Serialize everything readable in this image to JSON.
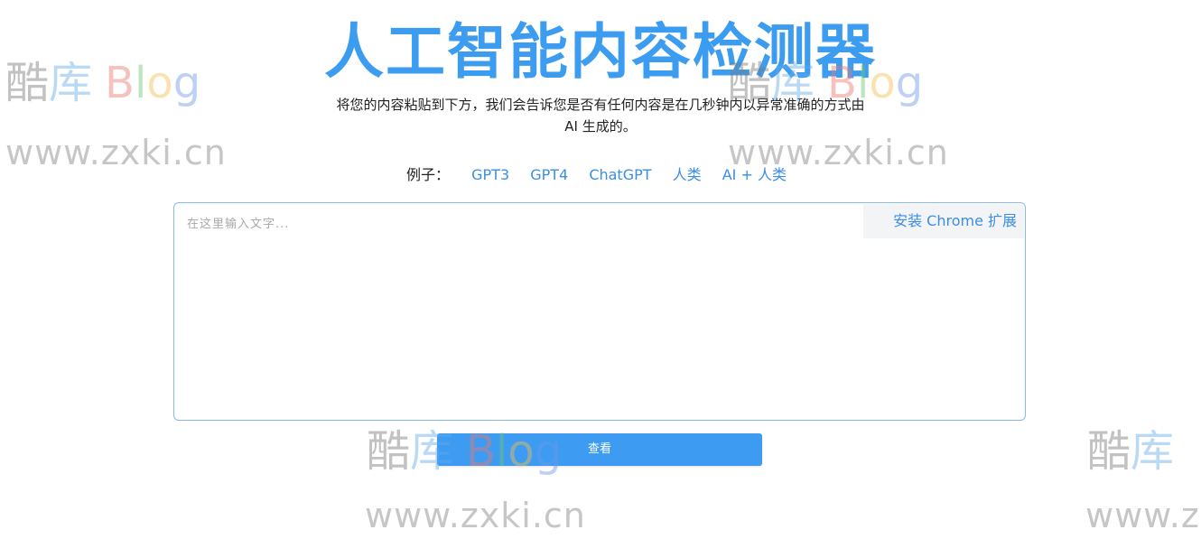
{
  "header": {
    "title": "人工智能内容检测器",
    "subtitle": "将您的内容粘贴到下方，我们会告诉您是否有任何内容是在几秒钟内以异常准确的方式由 AI 生成的。"
  },
  "examples": {
    "label": "例子：",
    "items": [
      "GPT3",
      "GPT4",
      "ChatGPT",
      "人类",
      "AI + 人类"
    ]
  },
  "editor": {
    "placeholder": "在这里输入文字...",
    "chrome_extension_label": "安装 Chrome 扩展"
  },
  "actions": {
    "check_label": "查看"
  },
  "watermark": {
    "chars": [
      "酷",
      "库",
      "B",
      "l",
      "o",
      "g"
    ],
    "url": "www.zxki.cn"
  },
  "colors": {
    "accent": "#3c9cf0",
    "link": "#3a8ee6",
    "border": "#86b9ee"
  }
}
